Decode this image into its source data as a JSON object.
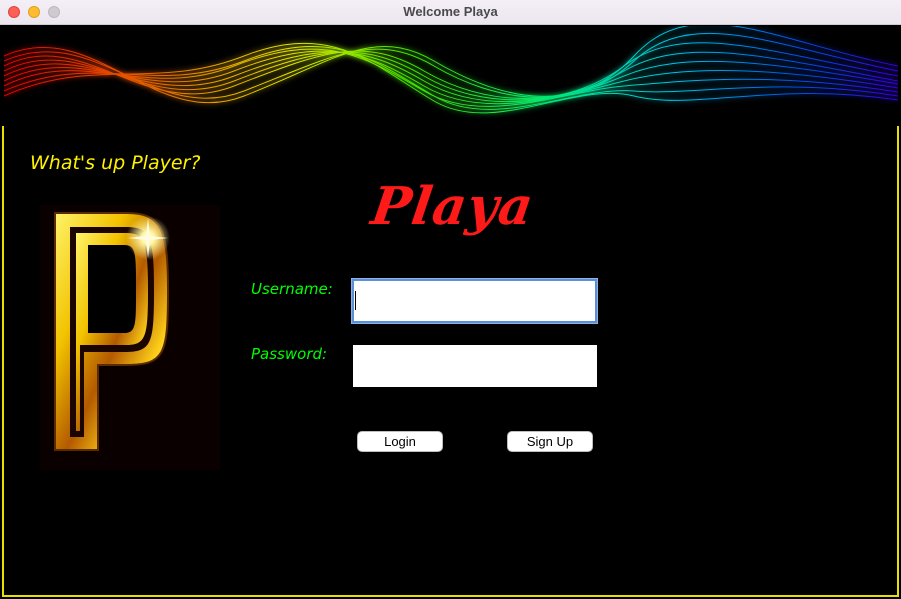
{
  "window": {
    "title": "Welcome Playa"
  },
  "greeting": "What's up Player?",
  "brand": "Playa",
  "logo": {
    "icon": "playa-p-logo-icon"
  },
  "form": {
    "username_label": "Username:",
    "username_value": "",
    "password_label": "Password:",
    "password_value": ""
  },
  "buttons": {
    "login": "Login",
    "signup": "Sign Up"
  },
  "colors": {
    "accent_yellow": "#fff200",
    "label_green": "#00ff00",
    "brand_red": "#ff1a1a",
    "border_yellow": "#e8e000"
  }
}
